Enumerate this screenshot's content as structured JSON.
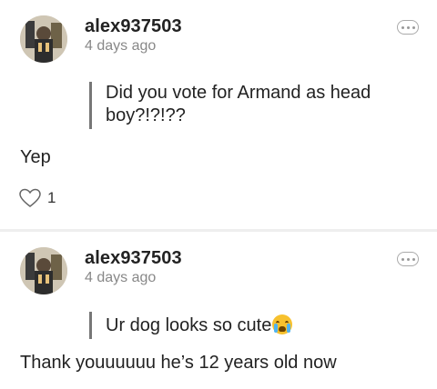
{
  "comments": [
    {
      "username": "alex937503",
      "time": "4 days ago",
      "quote": "Did you vote for Armand as head boy?!?!??",
      "reply": "Yep",
      "like_count": "1",
      "icons": {
        "like": "heart-icon",
        "more": "more-icon"
      }
    },
    {
      "username": "alex937503",
      "time": "4 days ago",
      "quote": "Ur dog looks so cute",
      "quote_emoji": "crying-face-emoji",
      "reply": "Thank youuuuuu he’s 12 years old now",
      "icons": {
        "more": "more-icon"
      }
    }
  ],
  "colors": {
    "text": "#222222",
    "meta": "#888888",
    "quote_bar": "#777777"
  }
}
